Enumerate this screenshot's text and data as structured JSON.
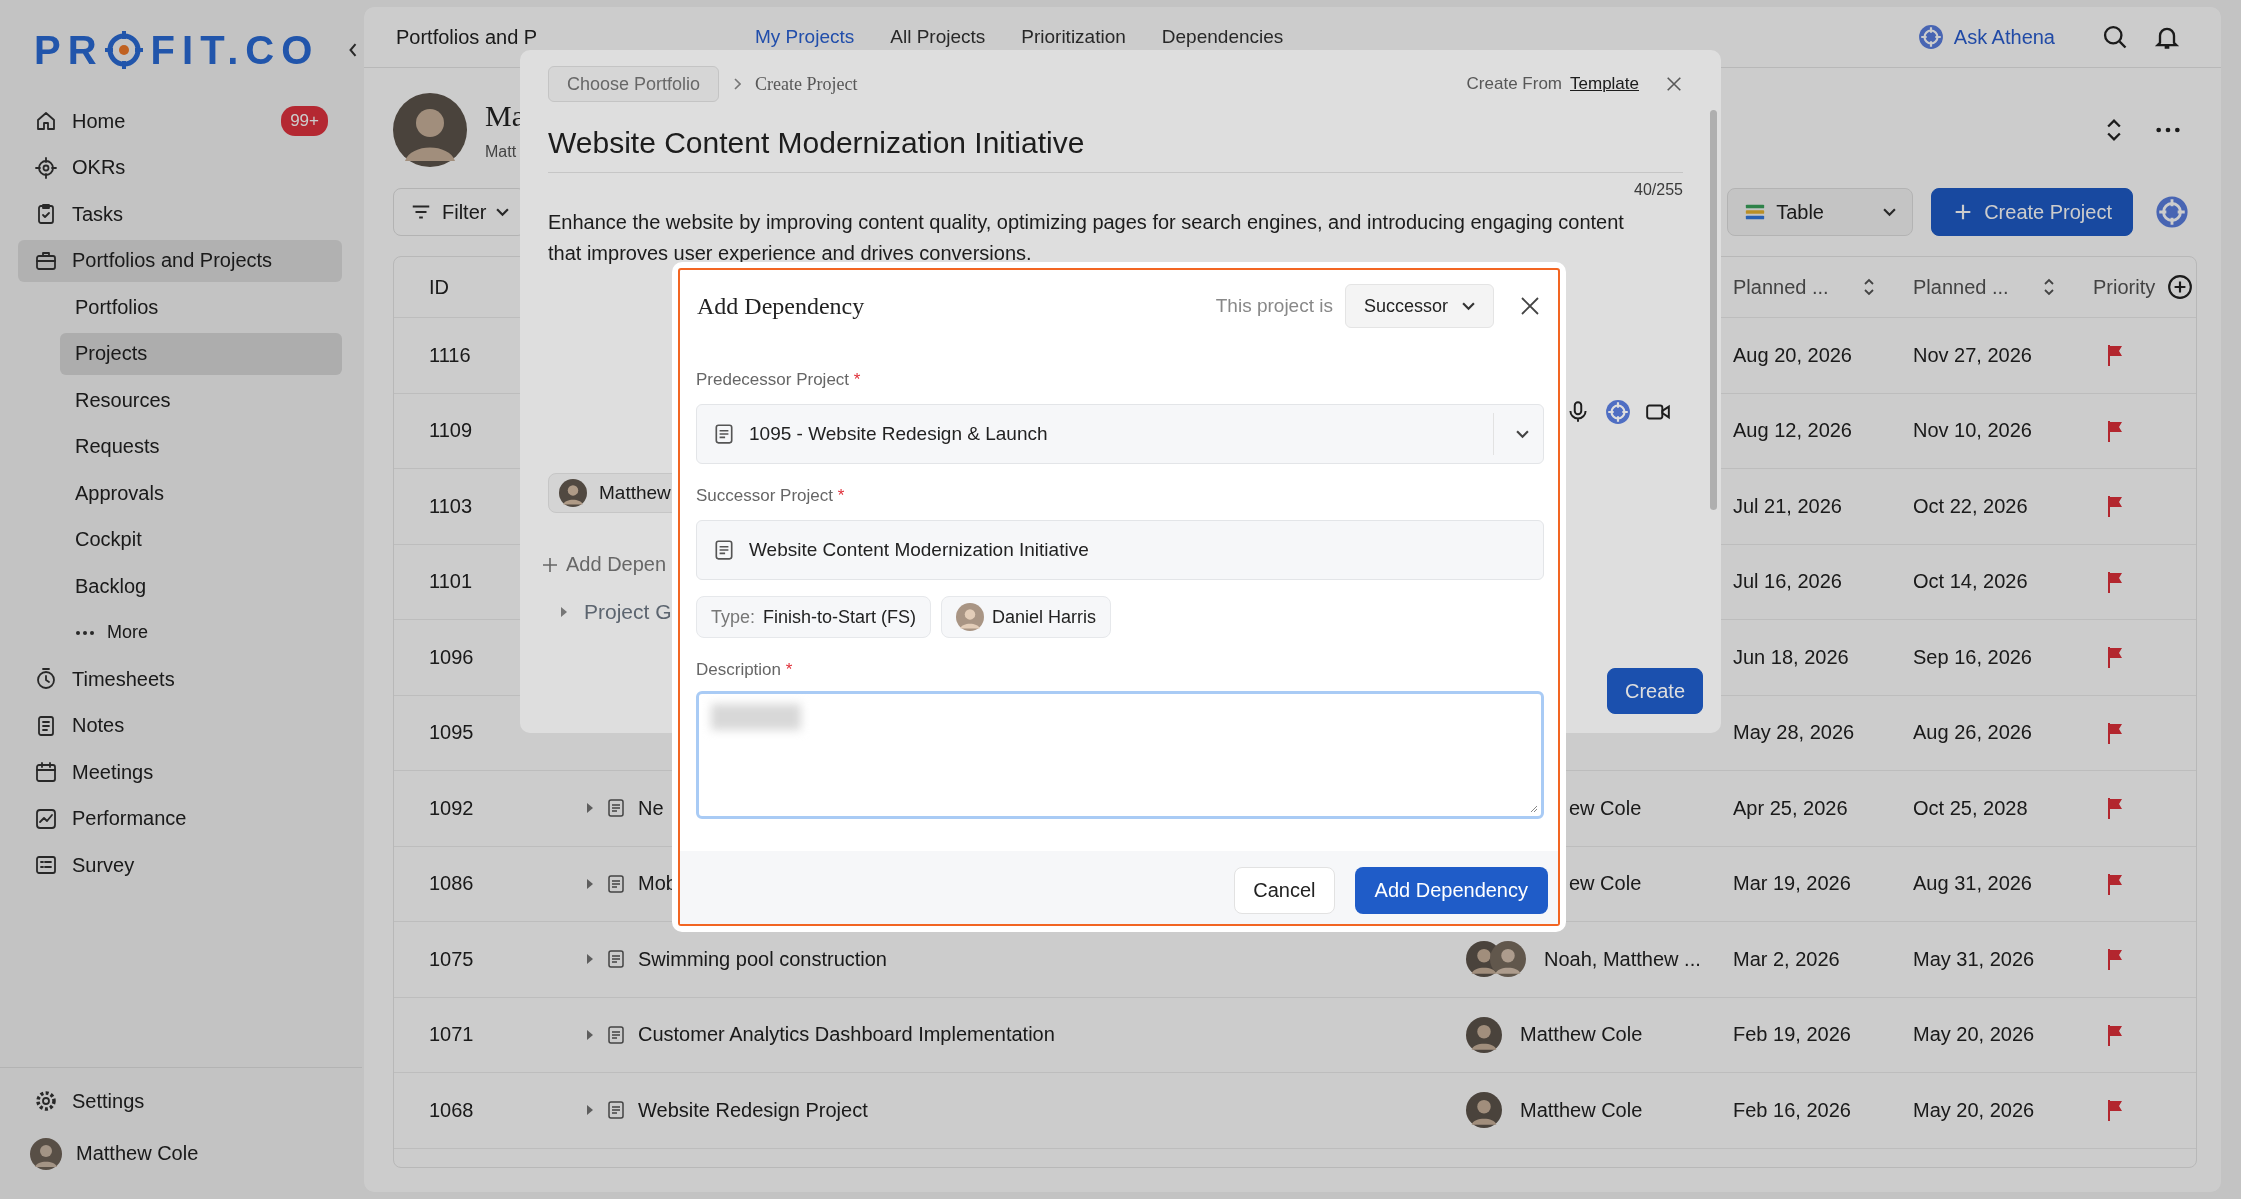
{
  "sidebar": {
    "logo": {
      "before": "PR",
      "after": "FIT.CO"
    },
    "nav": [
      {
        "label": "Home",
        "badge": "99+",
        "selected": false
      },
      {
        "label": "OKRs",
        "selected": false
      },
      {
        "label": "Tasks",
        "selected": false
      },
      {
        "label": "Portfolios and Projects",
        "selected": true,
        "children": [
          {
            "label": "Portfolios",
            "selected": false
          },
          {
            "label": "Projects",
            "selected": true
          },
          {
            "label": "Resources",
            "selected": false
          },
          {
            "label": "Requests",
            "selected": false
          },
          {
            "label": "Approvals",
            "selected": false
          },
          {
            "label": "Cockpit",
            "selected": false
          },
          {
            "label": "Backlog",
            "selected": false
          },
          {
            "label": "More",
            "selected": false,
            "kind": "more"
          }
        ]
      },
      {
        "label": "Timesheets",
        "selected": false
      },
      {
        "label": "Notes",
        "selected": false
      },
      {
        "label": "Meetings",
        "selected": false
      },
      {
        "label": "Performance",
        "selected": false
      },
      {
        "label": "Survey",
        "selected": false
      }
    ],
    "footer": [
      {
        "label": "Settings",
        "kind": "settings"
      },
      {
        "label": "Matthew Cole",
        "kind": "user"
      }
    ]
  },
  "topbar": {
    "breadcrumb": "Portfolios and P",
    "tabs": [
      {
        "label": "My Projects",
        "selected": true
      },
      {
        "label": "All Projects",
        "selected": false
      },
      {
        "label": "Prioritization",
        "selected": false
      },
      {
        "label": "Dependencies",
        "selected": false
      }
    ],
    "assistant": "Ask Athena"
  },
  "header": {
    "title": "Ma",
    "subtitle": "Matt"
  },
  "toolbar": {
    "filter": "Filter",
    "view": "Table",
    "create": "Create Project"
  },
  "table": {
    "columns": [
      {
        "label": "ID",
        "kind": "id"
      },
      {
        "label": "Planned ...",
        "kind": "sortable"
      },
      {
        "label": "Planned ...",
        "kind": "sortable"
      },
      {
        "label": "Priority",
        "kind": "add"
      }
    ],
    "rows": [
      {
        "id": "1116",
        "kind": "covered",
        "start": "Aug 20, 2026",
        "end": "Nov 27, 2026"
      },
      {
        "id": "1109",
        "kind": "covered",
        "start": "Aug 12, 2026",
        "end": "Nov 10, 2026"
      },
      {
        "id": "1103",
        "kind": "covered",
        "start": "Jul 21, 2026",
        "end": "Oct 22, 2026"
      },
      {
        "id": "1101",
        "kind": "covered",
        "start": "Jul 16, 2026",
        "end": "Oct 14, 2026"
      },
      {
        "id": "1096",
        "kind": "covered",
        "start": "Jun 18, 2026",
        "end": "Sep 16, 2026"
      },
      {
        "id": "1095",
        "kind": "covered",
        "start": "May 28, 2026",
        "end": "Aug 26, 2026"
      },
      {
        "id": "1092",
        "kind": "partial",
        "name": "Ne",
        "owner": "ew Cole",
        "start": "Apr 25, 2026",
        "end": "Oct 25, 2028"
      },
      {
        "id": "1086",
        "kind": "partial",
        "name": "Mob",
        "owner": "ew Cole",
        "start": "Mar 19, 2026",
        "end": "Aug 31, 2026"
      },
      {
        "id": "1075",
        "kind": "full",
        "name": "Swimming pool construction",
        "owner": "Noah, Matthew ...",
        "group": true,
        "start": "Mar 2, 2026",
        "end": "May 31, 2026"
      },
      {
        "id": "1071",
        "kind": "full",
        "name": "Customer Analytics Dashboard Implementation",
        "owner": "Matthew Cole",
        "group": false,
        "start": "Feb 19, 2026",
        "end": "May 20, 2026"
      },
      {
        "id": "1068",
        "kind": "full",
        "name": "Website Redesign Project",
        "owner": "Matthew Cole",
        "group": false,
        "start": "Feb 16, 2026",
        "end": "May 20, 2026"
      }
    ]
  },
  "create_modal": {
    "portfolio_button": "Choose Portfolio",
    "crumb": "Create Project",
    "from_label": "Create From",
    "from_link": "Template",
    "title": "Website Content Modernization Initiative",
    "counter": "40/255",
    "description": "Enhance the website by improving content quality, optimizing pages for search engines, and introducing engaging content that improves user experience and drives conversions.",
    "assignee": "Matthew",
    "add_link": "Add Depen",
    "section": "Project G",
    "create": "Create"
  },
  "dependency_modal": {
    "title": "Add Dependency",
    "role_label": "This project is",
    "role": "Successor",
    "predecessor": {
      "label": "Predecessor Project",
      "mark": "*",
      "value": "1095 - Website Redesign & Launch"
    },
    "successor": {
      "label": "Successor Project",
      "mark": "*",
      "value": "Website Content Modernization Initiative"
    },
    "type": {
      "label": "Type:",
      "value": "Finish-to-Start (FS)"
    },
    "owner": "Daniel Harris",
    "description": {
      "label": "Description",
      "mark": "*"
    },
    "cancel": "Cancel",
    "submit": "Add Dependency"
  }
}
